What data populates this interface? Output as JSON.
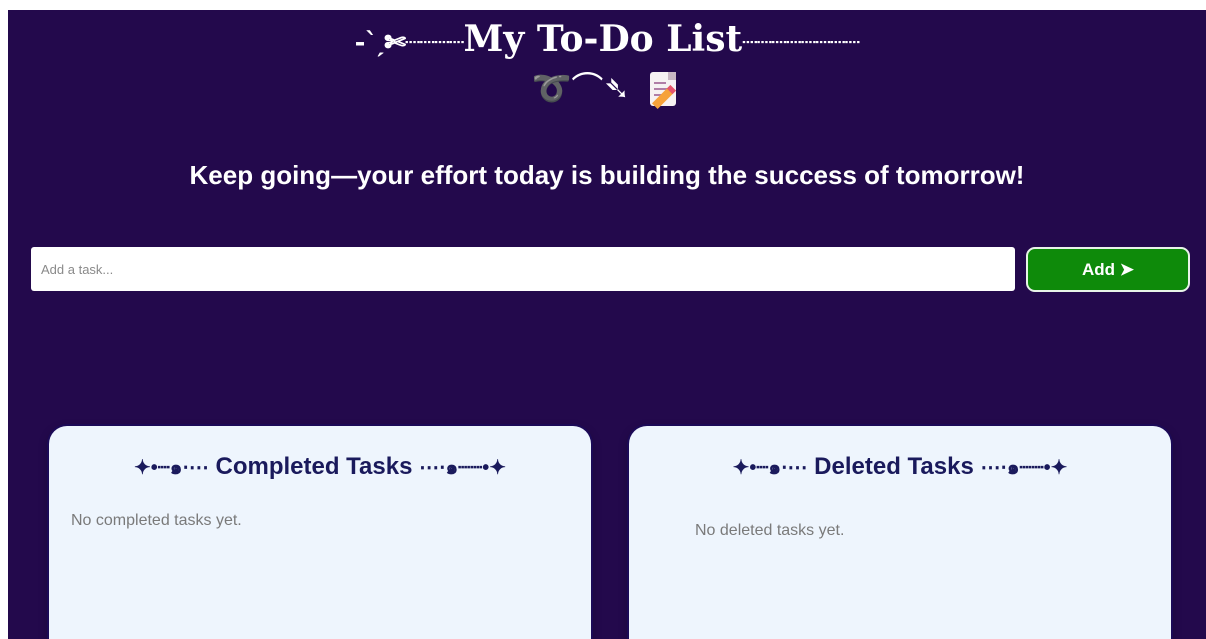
{
  "header": {
    "title_prefix": "-ˋˏ✄┈┈┈┈",
    "title": "My To-Do List",
    "title_suffix": "┈┈┈┈┈┈┈┈",
    "decoration": "➰⌒➴",
    "memo_icon": "memo-icon"
  },
  "motivation": "Keep going—your effort today is building the success of tomorrow!",
  "task_input": {
    "placeholder": "Add a task...",
    "value": ""
  },
  "add_button": {
    "label": "Add ➤",
    "color": "#0e8a0a"
  },
  "panels": {
    "completed": {
      "ornament_left": "✦•┈๑⋅⋯",
      "title": "Completed Tasks",
      "ornament_right": "⋯⋅๑┈┈•✦",
      "empty_text": "No completed tasks yet."
    },
    "deleted": {
      "ornament_left": "✦•┈๑⋅⋯",
      "title": "Deleted Tasks",
      "ornament_right": "⋯⋅๑┈┈•✦",
      "empty_text": "No deleted tasks yet."
    }
  },
  "colors": {
    "background": "#23094c",
    "panel": "#eef5fd",
    "heading": "#1a1a5c"
  }
}
